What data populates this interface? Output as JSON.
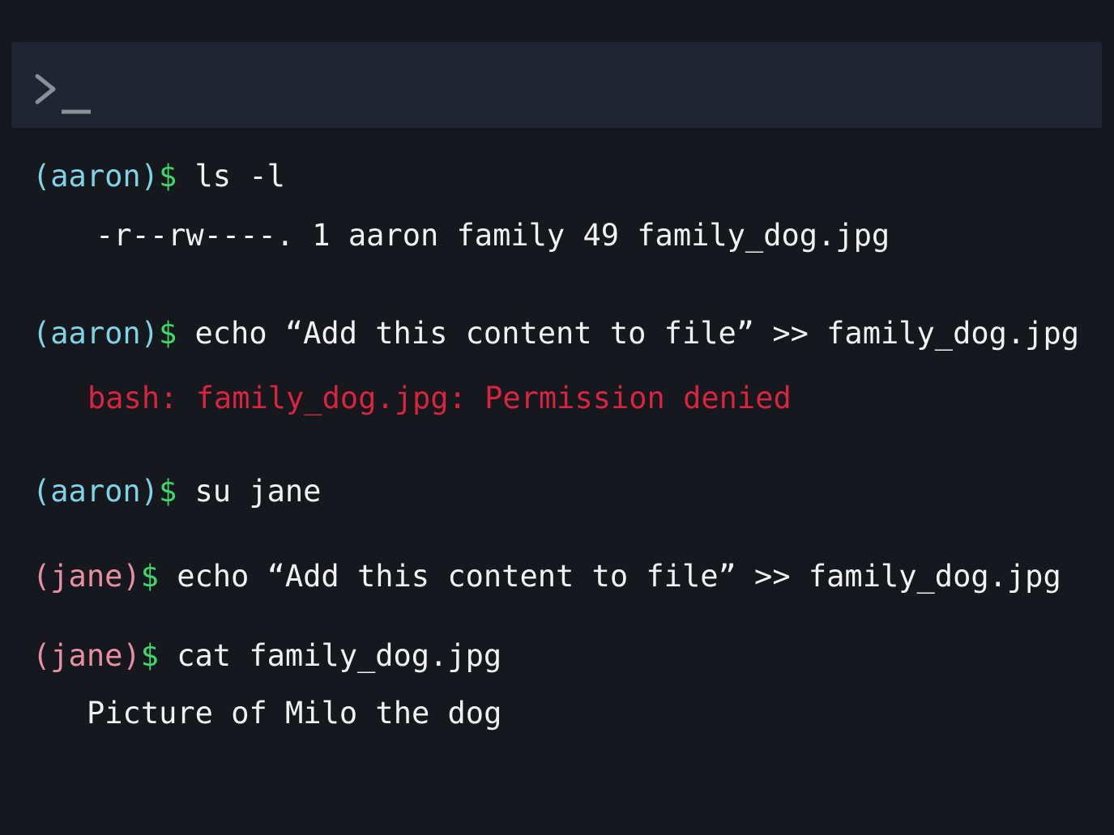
{
  "header": {
    "icon": "terminal-prompt-icon"
  },
  "colors": {
    "aaron": "#7fd3e6",
    "jane": "#e88fa2",
    "dollar": "#3fd66a",
    "error": "#d8243f",
    "text": "#f2f2f2",
    "background": "#15181d",
    "bar": "#1f2631"
  },
  "lines": [
    {
      "user": "(aaron)",
      "sym": "$",
      "cmd": " ls -l"
    },
    {
      "output": "-r--rw----. 1 aaron family 49 family_dog.jpg"
    },
    {
      "user": "(aaron)",
      "sym": "$",
      "cmd": " echo “Add this content to file” >> family_dog.jpg"
    },
    {
      "output": "bash: family_dog.jpg: Permission denied"
    },
    {
      "user": "(aaron)",
      "sym": "$",
      "cmd": " su jane"
    },
    {
      "user": "(jane)",
      "sym": "$",
      "cmd": " echo “Add this content to file” >> family_dog.jpg"
    },
    {
      "user": "(jane)",
      "sym": "$",
      "cmd": " cat family_dog.jpg"
    },
    {
      "output": "Picture of Milo the dog"
    }
  ]
}
